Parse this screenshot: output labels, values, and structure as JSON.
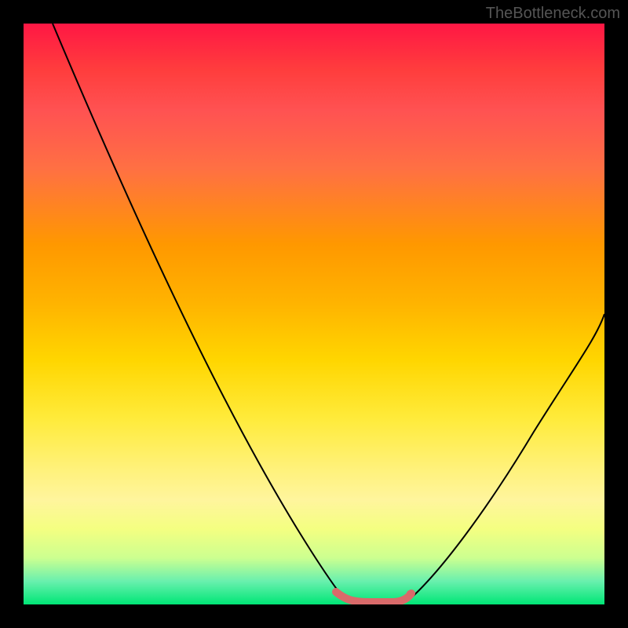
{
  "watermark": "TheBottleneck.com",
  "chart_data": {
    "type": "line",
    "title": "",
    "xlabel": "",
    "ylabel": "",
    "xlim": [
      0,
      100
    ],
    "ylim": [
      0,
      100
    ],
    "series": [
      {
        "name": "left-curve",
        "x": [
          5,
          10,
          15,
          20,
          25,
          30,
          35,
          40,
          45,
          50,
          55
        ],
        "y": [
          100,
          90,
          80,
          70,
          59,
          48,
          37,
          26,
          15,
          5,
          0
        ]
      },
      {
        "name": "valley-highlight",
        "x": [
          54,
          56,
          58,
          60,
          62,
          64,
          66
        ],
        "y": [
          0.5,
          0,
          0,
          0,
          0,
          0,
          0.5
        ]
      },
      {
        "name": "right-curve",
        "x": [
          66,
          70,
          75,
          80,
          85,
          90,
          95,
          100
        ],
        "y": [
          0,
          4,
          10,
          17,
          25,
          33,
          42,
          50
        ]
      }
    ],
    "colors": {
      "curve": "#000000",
      "highlight": "#e57373",
      "gradient_top": "#ff1744",
      "gradient_bottom": "#00e676"
    }
  }
}
